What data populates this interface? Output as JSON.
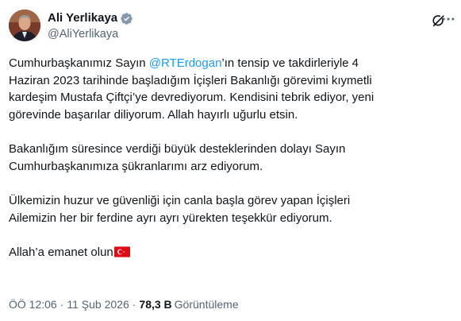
{
  "author": {
    "display_name": "Ali Yerlikaya",
    "handle": "@AliYerlikaya",
    "verified_badge_color": "#829aab"
  },
  "tweet": {
    "p1_before": "Cumhurbaşkanımız Sayın ",
    "p1_mention": "@RTErdogan",
    "p1_after": "’ın tensip ve takdirleriyle 4\nHaziran 2023 tarihinde başladığım İçişleri Bakanlığı görevimi kıymetli\nkardeşim Mustafa Çiftçi’ye devrediyorum. Kendisini tebrik ediyor, yeni\ngörevinde başarılar diliyorum. Allah hayırlı uğurlu etsin.",
    "p2": "Bakanlığım süresince verdiği büyük desteklerinden dolayı Sayın\nCumhurbaşkanımıza şükranlarımı arz ediyorum.",
    "p3": "Ülkemizin huzur ve güvenliği için canla başla görev yapan İçişleri\nAilemizin her bir ferdine ayrı ayrı yürekten teşekkür ediyorum.",
    "p4": "Allah’a emanet olun",
    "flag_icon": "turkey-flag-icon"
  },
  "meta": {
    "time": "ÖÖ 12:06",
    "date": "11 Şub 2026",
    "views_count": "78,3 B",
    "views_label": "Görüntüleme"
  },
  "colors": {
    "link": "#1d9bf0",
    "secondary_text": "#536471",
    "primary_text": "#0f1419"
  },
  "icons": {
    "grok": "grok-icon",
    "more": "more-options-icon"
  }
}
